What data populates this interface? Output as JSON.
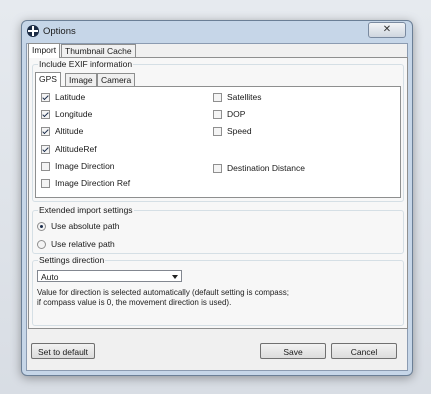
{
  "window": {
    "title": "Options",
    "close_glyph": "✕"
  },
  "tabs": {
    "import": "Import",
    "thumbnail_cache": "Thumbnail Cache"
  },
  "exif": {
    "group_label": "Include EXIF information",
    "tabs": {
      "gps": "GPS",
      "image": "Image",
      "camera": "Camera"
    },
    "gps_items": {
      "latitude": {
        "label": "Latitude",
        "checked": true
      },
      "longitude": {
        "label": "Longitude",
        "checked": true
      },
      "altitude": {
        "label": "Altitude",
        "checked": true
      },
      "altitude_ref": {
        "label": "AltitudeRef",
        "checked": true
      },
      "image_direction": {
        "label": "Image Direction",
        "checked": false
      },
      "image_direction_ref": {
        "label": "Image Direction Ref",
        "checked": false
      },
      "satellites": {
        "label": "Satellites",
        "checked": false
      },
      "dop": {
        "label": "DOP",
        "checked": false
      },
      "speed": {
        "label": "Speed",
        "checked": false
      },
      "destination_distance": {
        "label": "Destination Distance",
        "checked": false
      }
    }
  },
  "extended": {
    "group_label": "Extended import settings",
    "absolute": "Use absolute path",
    "relative": "Use relative path",
    "selected": "absolute"
  },
  "direction": {
    "group_label": "Settings direction",
    "selected": "Auto",
    "note_line1": "Value for direction is selected automatically (default setting is compass;",
    "note_line2": "if compass value is 0, the movement direction is used)."
  },
  "buttons": {
    "set_default": "Set to default",
    "save": "Save",
    "cancel": "Cancel"
  },
  "colors": {
    "title_bar": "#c6d6e8",
    "client": "#f0f0f0",
    "check": "#1d2f4d"
  }
}
